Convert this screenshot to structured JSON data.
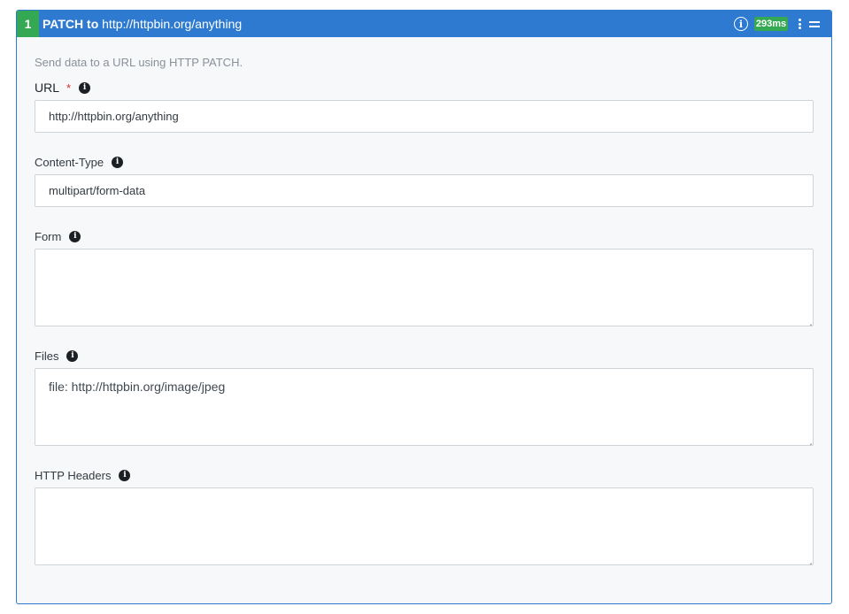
{
  "header": {
    "step_number": "1",
    "method_label": "PATCH to",
    "url": "http://httpbin.org/anything",
    "info_icon": "info-circle-icon",
    "timing": "293ms",
    "menu_icon": "kebab-menu-icon",
    "drag_icon": "drag-handle-icon"
  },
  "description": "Send data to a URL using HTTP PATCH.",
  "fields": {
    "url": {
      "label": "URL",
      "required_marker": "*",
      "value": "http://httpbin.org/anything"
    },
    "content_type": {
      "label": "Content-Type",
      "value": "multipart/form-data"
    },
    "form": {
      "label": "Form",
      "value": ""
    },
    "files": {
      "label": "Files",
      "value": "file: http://httpbin.org/image/jpeg"
    },
    "http_headers": {
      "label": "HTTP Headers",
      "value": ""
    }
  },
  "colors": {
    "header_bg": "#2d7ad0",
    "step_badge": "#34a853",
    "timing_badge": "#34a853",
    "required": "#d93025"
  }
}
